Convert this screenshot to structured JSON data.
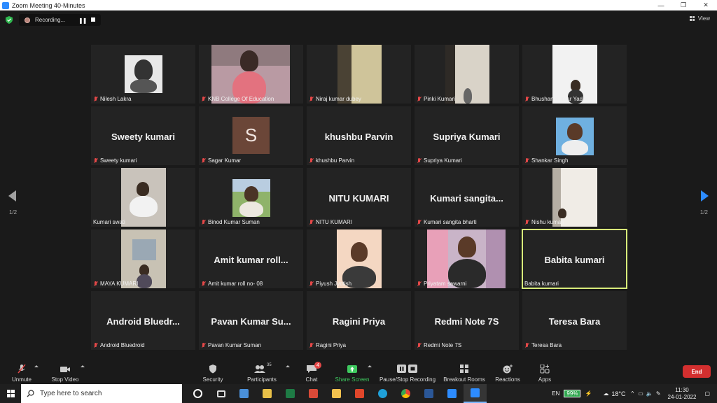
{
  "window": {
    "title": "Zoom Meeting 40-Minutes"
  },
  "recording": {
    "label": "Recording..."
  },
  "view": {
    "label": "View"
  },
  "pager": {
    "left": "1/2",
    "right": "1/2"
  },
  "tiles": [
    {
      "label": "Nilesh Lakra",
      "display": ""
    },
    {
      "label": "KNB College Of Education",
      "display": ""
    },
    {
      "label": "Niraj kumar dubey",
      "display": ""
    },
    {
      "label": "Pinki Kumari",
      "display": ""
    },
    {
      "label": "Bhushan Kumar Yadav",
      "display": ""
    },
    {
      "label": "Sweety kumari",
      "display": "Sweety kumari"
    },
    {
      "label": "Sagar Kumar",
      "display": "",
      "avatar": "S"
    },
    {
      "label": "khushbu Parvin",
      "display": "khushbu Parvin"
    },
    {
      "label": "Supriya Kumari",
      "display": "Supriya Kumari"
    },
    {
      "label": "Shankar Singh",
      "display": ""
    },
    {
      "label": "Kumari swati",
      "display": ""
    },
    {
      "label": "Binod Kumar Suman",
      "display": ""
    },
    {
      "label": "NITU KUMARI",
      "display": "NITU KUMARI"
    },
    {
      "label": "Kumari sangita bharti",
      "display": "Kumari  sangita..."
    },
    {
      "label": "Nishu kumari",
      "display": ""
    },
    {
      "label": "MAYA KUMARI",
      "display": ""
    },
    {
      "label": "Amit kumar roll no- 08",
      "display": "Amit  kumar  roll..."
    },
    {
      "label": "Piyush Jyotish",
      "display": ""
    },
    {
      "label": "Priyatam sawarni",
      "display": ""
    },
    {
      "label": "Babita kumari",
      "display": "Babita kumari"
    },
    {
      "label": "Android Bluedroid",
      "display": "Android  Bluedr..."
    },
    {
      "label": "Pavan Kumar Suman",
      "display": "Pavan  Kumar  Su..."
    },
    {
      "label": "Ragini  Priya",
      "display": "Ragini  Priya"
    },
    {
      "label": "Redmi Note 7S",
      "display": "Redmi Note 7S"
    },
    {
      "label": "Teresa Bara",
      "display": "Teresa Bara"
    }
  ],
  "toolbar": {
    "unmute": "Unmute",
    "stop_video": "Stop Video",
    "security": "Security",
    "participants": "Participants",
    "participants_count": "35",
    "chat": "Chat",
    "chat_badge": "4",
    "share_screen": "Share Screen",
    "pause_stop_recording": "Pause/Stop Recording",
    "breakout_rooms": "Breakout Rooms",
    "reactions": "Reactions",
    "apps": "Apps",
    "end": "End"
  },
  "taskbar": {
    "search_placeholder": "Type here to search",
    "language": "EN",
    "battery": "99%",
    "temperature": "18°C",
    "time": "11:30",
    "date": "24-01-2022"
  },
  "colors": {
    "accent": "#2d8cff",
    "active_speaker": "#d8ec7a",
    "share_green": "#3ec95f",
    "end_red": "#d32f2f"
  }
}
